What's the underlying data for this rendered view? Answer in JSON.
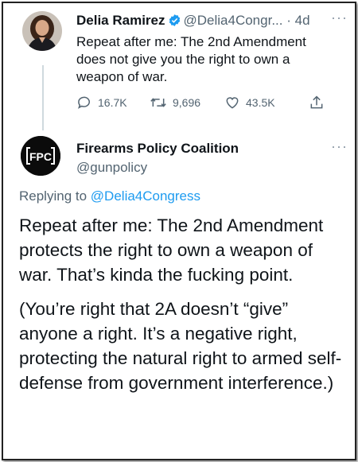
{
  "tweet1": {
    "author_name": "Delia Ramirez",
    "author_handle": "@Delia4Congr...",
    "separator": "·",
    "time": "4d",
    "text": "Repeat after me: The 2nd Amendment does not give you the right to own a weapon of war.",
    "replies": "16.7K",
    "retweets": "9,696",
    "likes": "43.5K"
  },
  "tweet2": {
    "author_name": "Firearms Policy Coalition",
    "author_handle": "@gunpolicy",
    "avatar_text": "FPC",
    "replying_prefix": "Replying to",
    "replying_handle": "@Delia4Congress",
    "paragraph1": "Repeat after me: The 2nd Amendment protects the right to own a weapon of war. That’s kinda the fucking point.",
    "paragraph2": "(You’re right that 2A doesn’t “give” anyone a right. It’s a negative right, protecting the natural right to armed self-defense from government interference.)"
  },
  "colors": {
    "verified": "#1d9bf0",
    "link": "#1d9bf0",
    "secondary_text": "#536471"
  },
  "icons": {
    "more": "more-icon",
    "reply": "reply-icon",
    "retweet": "retweet-icon",
    "like": "heart-icon",
    "share": "share-icon",
    "verified": "verified-badge-icon"
  }
}
